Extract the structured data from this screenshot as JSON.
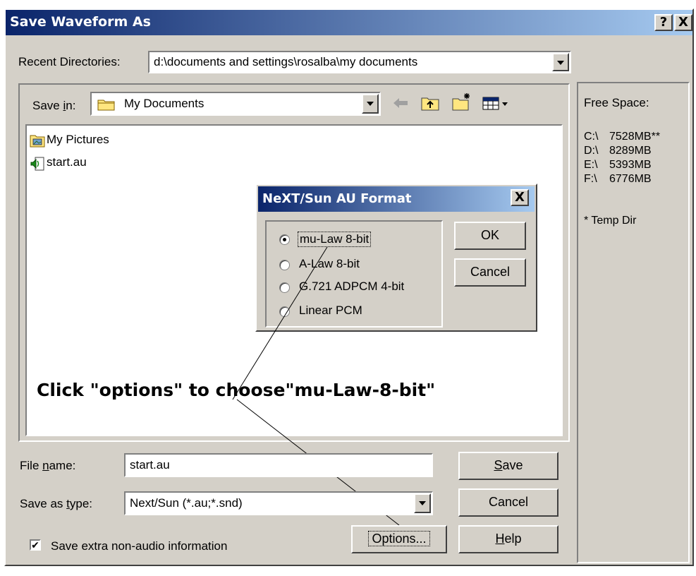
{
  "window": {
    "title": "Save Waveform As",
    "help_glyph": "?",
    "close_glyph": "X"
  },
  "recent": {
    "label": "Recent Directories:",
    "value": "d:\\documents and settings\\rosalba\\my documents"
  },
  "save_in": {
    "label_pre": "Save ",
    "label_u": "i",
    "label_post": "n:",
    "value": "My Documents"
  },
  "files": [
    {
      "name": "My Pictures",
      "icon": "folder-picture-icon"
    },
    {
      "name": "start.au",
      "icon": "audio-file-icon"
    }
  ],
  "free_space": {
    "title": "Free Space:",
    "drives": [
      {
        "drive": "C:\\",
        "size": "7528MB**"
      },
      {
        "drive": "D:\\",
        "size": "8289MB"
      },
      {
        "drive": "E:\\",
        "size": "5393MB"
      },
      {
        "drive": "F:\\",
        "size": "6776MB"
      }
    ],
    "note": "* Temp Dir"
  },
  "au_dialog": {
    "title": "NeXT/Sun AU Format",
    "close_glyph": "X",
    "options": [
      "mu-Law 8-bit",
      "A-Law 8-bit",
      "G.721 ADPCM 4-bit",
      "Linear PCM"
    ],
    "selected": "mu-Law 8-bit",
    "ok_label": "OK",
    "cancel_label": "Cancel"
  },
  "annotation": "Click \"options\" to choose\"mu-Law-8-bit\"",
  "filename": {
    "label_pre": "File ",
    "label_u": "n",
    "label_post": "ame:",
    "value": "start.au"
  },
  "savetype": {
    "label_pre": "Save as ",
    "label_u": "t",
    "label_post": "ype:",
    "value": "Next/Sun (*.au;*.snd)"
  },
  "buttons": {
    "save_u": "S",
    "save_rest": "ave",
    "cancel": "Cancel",
    "options": "Options...",
    "help_u": "H",
    "help_rest": "elp"
  },
  "extra_info": {
    "label": "Save extra non-audio information",
    "checked": true,
    "check_glyph": "✔"
  },
  "colors": {
    "title_start": "#0a246a",
    "title_end": "#a6caf0",
    "face": "#d4d0c8"
  }
}
